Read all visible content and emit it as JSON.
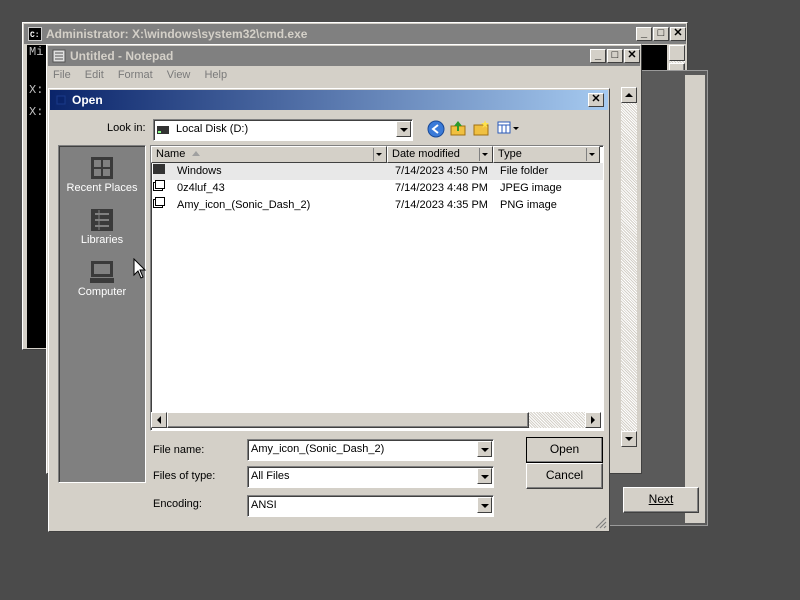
{
  "cmd": {
    "title": "Administrator: X:\\windows\\system32\\cmd.exe",
    "lines": [
      "Mi",
      "X:",
      "X:"
    ]
  },
  "notepad": {
    "title": "Untitled - Notepad",
    "menu": [
      "File",
      "Edit",
      "Format",
      "View",
      "Help"
    ]
  },
  "wizard": {
    "next_label": "Next"
  },
  "dialog": {
    "title": "Open",
    "look_in_label": "Look in:",
    "look_in_value": "Local Disk (D:)",
    "places": [
      {
        "label": "Recent Places",
        "icon": "recent-places-icon"
      },
      {
        "label": "Libraries",
        "icon": "libraries-icon"
      },
      {
        "label": "Computer",
        "icon": "computer-icon"
      }
    ],
    "columns": [
      "Name",
      "Date modified",
      "Type"
    ],
    "files": [
      {
        "name": "Windows",
        "date": "7/14/2023 4:50 PM",
        "type": "File folder",
        "icon": "folder-icon"
      },
      {
        "name": "0z4luf_43",
        "date": "7/14/2023 4:48 PM",
        "type": "JPEG image",
        "icon": "image-file-icon"
      },
      {
        "name": "Amy_icon_(Sonic_Dash_2)",
        "date": "7/14/2023 4:35 PM",
        "type": "PNG image",
        "icon": "image-file-icon"
      }
    ],
    "file_name_label": "File name:",
    "file_name_value": "Amy_icon_(Sonic_Dash_2)",
    "file_type_label": "Files of type:",
    "file_type_value": "All Files",
    "encoding_label": "Encoding:",
    "encoding_value": "ANSI",
    "open_label": "Open",
    "cancel_label": "Cancel"
  },
  "colors": {
    "desktop": "#4b4b4b",
    "face": "#d4d0c8",
    "active_title_start": "#0a246a",
    "active_title_end": "#a6caf0",
    "inactive_title": "#808080"
  }
}
